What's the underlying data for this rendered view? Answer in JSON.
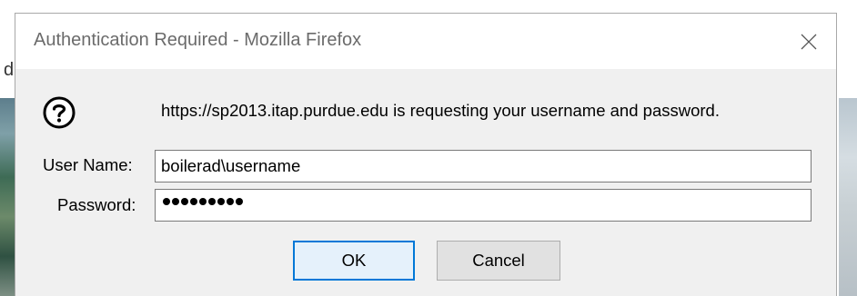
{
  "window": {
    "title": "Authentication Required - Mozilla Firefox",
    "close_icon": "close-icon"
  },
  "background": {
    "left_glyph": "d"
  },
  "dialog": {
    "icon": "question-icon",
    "message": "https://sp2013.itap.purdue.edu is requesting your username and password.",
    "username_label": "User Name:",
    "username_value": "boilerad\\username",
    "password_label": "Password:",
    "password_masked": "•••••••••",
    "password_length": 9,
    "ok_label": "OK",
    "cancel_label": "Cancel"
  },
  "colors": {
    "accent_focus": "#0078d7",
    "dialog_bg": "#f0f0f0",
    "title_text": "#6b6b6b"
  }
}
